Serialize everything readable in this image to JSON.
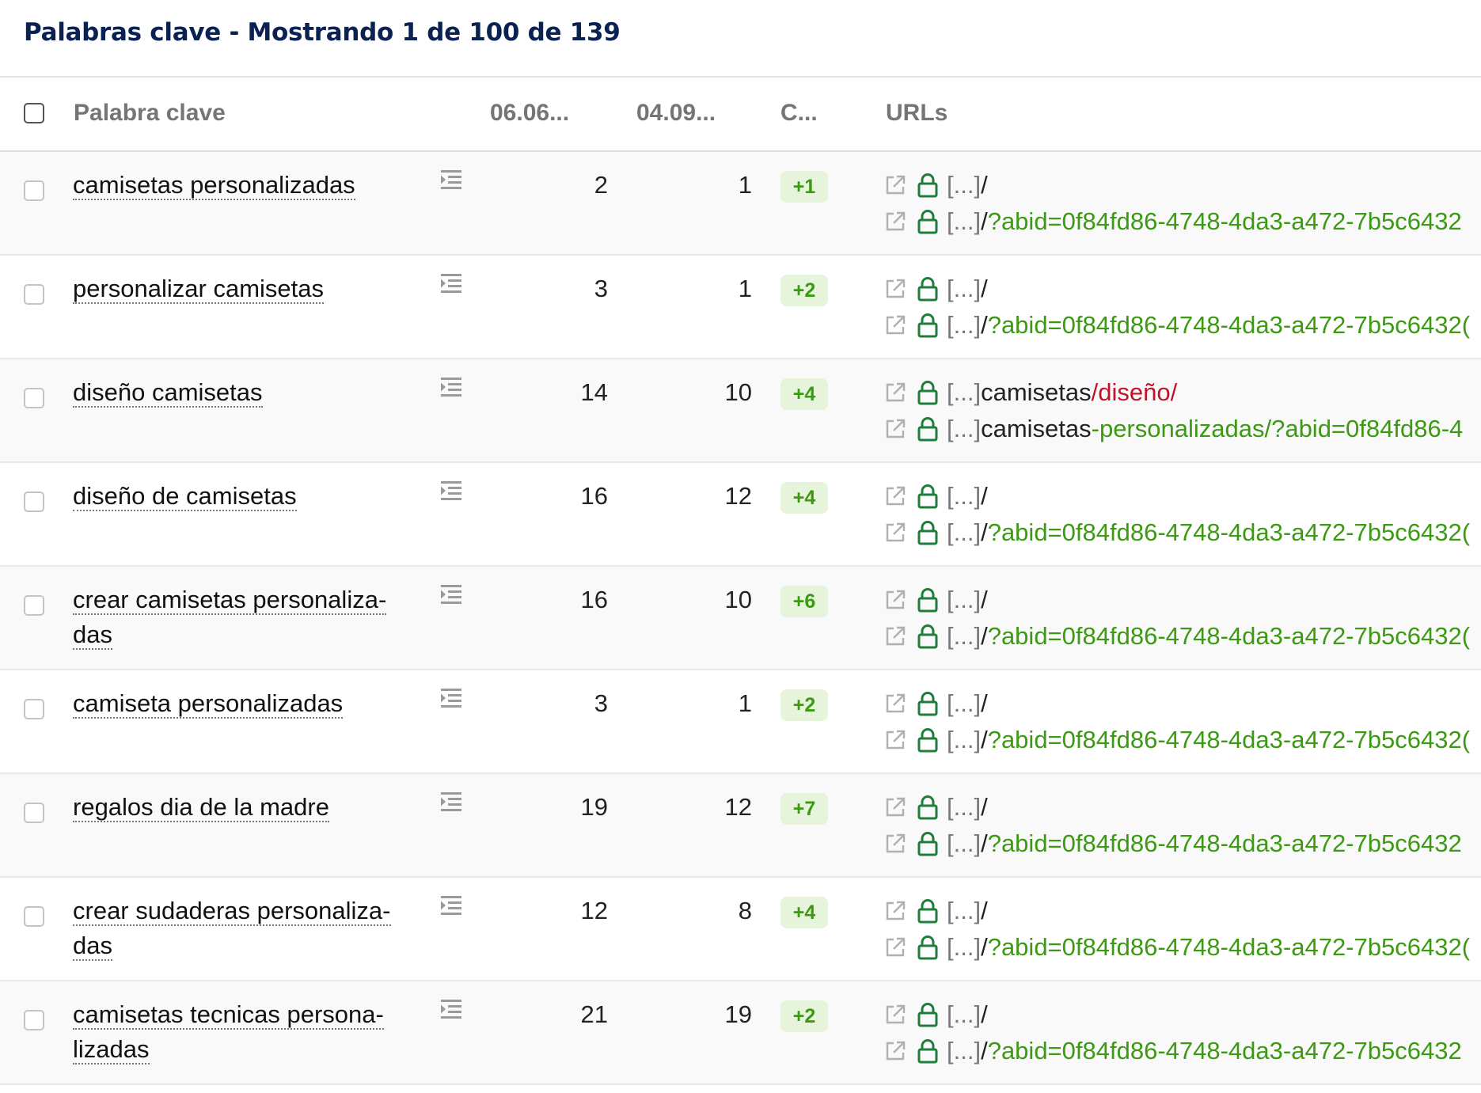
{
  "header": {
    "title": "Palabras clave - Mostrando 1 de 100 de 139"
  },
  "columns": {
    "keyword": "Palabra clave",
    "date1": "06.06...",
    "date2": "04.09...",
    "change": "C...",
    "urls": "URLs"
  },
  "url_prefix": "[...]",
  "colors": {
    "title": "#0a2152",
    "green": "#3b9a12",
    "red": "#c0142a",
    "badge_bg": "#e6f4dc"
  },
  "icons": {
    "row_action": "indent-icon",
    "open_link": "external-link-icon",
    "secure": "lock-icon"
  },
  "rows": [
    {
      "keyword": "camisetas personalizadas",
      "v1": "2",
      "v2": "1",
      "change": "+1",
      "url1": {
        "base": "/",
        "tail": "",
        "tail_color": ""
      },
      "url2": {
        "base": "/",
        "tail": "?abid=0f84fd86-4748-4da3-a472-7b5c6432",
        "tail_color": "green"
      }
    },
    {
      "keyword": "personalizar camisetas",
      "v1": "3",
      "v2": "1",
      "change": "+2",
      "url1": {
        "base": "/",
        "tail": "",
        "tail_color": ""
      },
      "url2": {
        "base": "/",
        "tail": "?abid=0f84fd86-4748-4da3-a472-7b5c6432(",
        "tail_color": "green"
      }
    },
    {
      "keyword": "diseño camisetas",
      "v1": "14",
      "v2": "10",
      "change": "+4",
      "url1": {
        "base": "camisetas",
        "tail": "/diseño/",
        "tail_color": "red"
      },
      "url2": {
        "base": "camisetas",
        "tail": "-personalizadas/?abid=0f84fd86-4",
        "tail_color": "green"
      }
    },
    {
      "keyword": "diseño de camisetas",
      "v1": "16",
      "v2": "12",
      "change": "+4",
      "url1": {
        "base": "/",
        "tail": "",
        "tail_color": ""
      },
      "url2": {
        "base": "/",
        "tail": "?abid=0f84fd86-4748-4da3-a472-7b5c6432(",
        "tail_color": "green"
      }
    },
    {
      "keyword": "crear camisetas personaliza-das",
      "v1": "16",
      "v2": "10",
      "change": "+6",
      "url1": {
        "base": "/",
        "tail": "",
        "tail_color": ""
      },
      "url2": {
        "base": "/",
        "tail": "?abid=0f84fd86-4748-4da3-a472-7b5c6432(",
        "tail_color": "green"
      }
    },
    {
      "keyword": "camiseta personalizadas",
      "v1": "3",
      "v2": "1",
      "change": "+2",
      "url1": {
        "base": "/",
        "tail": "",
        "tail_color": ""
      },
      "url2": {
        "base": "/",
        "tail": "?abid=0f84fd86-4748-4da3-a472-7b5c6432(",
        "tail_color": "green"
      }
    },
    {
      "keyword": "regalos dia de la madre",
      "v1": "19",
      "v2": "12",
      "change": "+7",
      "url1": {
        "base": "/",
        "tail": "",
        "tail_color": ""
      },
      "url2": {
        "base": "/",
        "tail": "?abid=0f84fd86-4748-4da3-a472-7b5c6432",
        "tail_color": "green"
      }
    },
    {
      "keyword": "crear sudaderas personaliza-das",
      "v1": "12",
      "v2": "8",
      "change": "+4",
      "url1": {
        "base": "/",
        "tail": "",
        "tail_color": ""
      },
      "url2": {
        "base": "/",
        "tail": "?abid=0f84fd86-4748-4da3-a472-7b5c6432(",
        "tail_color": "green"
      }
    },
    {
      "keyword": "camisetas tecnicas persona-lizadas",
      "v1": "21",
      "v2": "19",
      "change": "+2",
      "url1": {
        "base": "/",
        "tail": "",
        "tail_color": ""
      },
      "url2": {
        "base": "/",
        "tail": "?abid=0f84fd86-4748-4da3-a472-7b5c6432",
        "tail_color": "green"
      }
    }
  ]
}
